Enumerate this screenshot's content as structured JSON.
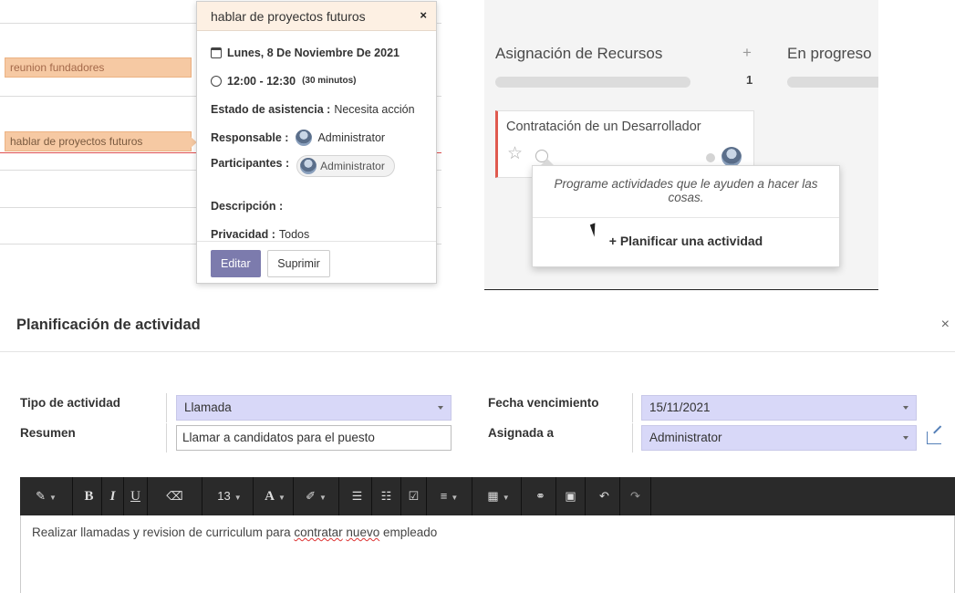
{
  "calendar": {
    "events": [
      {
        "label": "reunion fundadores"
      },
      {
        "label": "hablar de proyectos futuros"
      }
    ],
    "popover": {
      "title": "hablar de proyectos futuros",
      "close": "×",
      "date": "Lunes, 8 De Noviembre De 2021",
      "time": "12:00 - 12:30",
      "duration": "(30 minutos)",
      "attendance_label": "Estado de asistencia :",
      "attendance_value": "Necesita acción",
      "responsible_label": "Responsable :",
      "responsible_value": "Administrator",
      "participants_label": "Participantes :",
      "participant": "Administrator",
      "description_label": "Descripción :",
      "privacy_label": "Privacidad :",
      "privacy_value": "Todos",
      "edit_label": "Editar",
      "delete_label": "Suprimir",
      "edit_color": "#7c7bad"
    }
  },
  "kanban": {
    "column1_title": "Asignación de Recursos",
    "column1_add": "+",
    "column1_count": "1",
    "column2_title": "En progreso",
    "card": {
      "title": "Contratación de un Desarrollador",
      "priority_icon": "star-icon",
      "activity_icon": "clock-icon",
      "stripe_color": "#e05a4f"
    },
    "activity_popup": {
      "message": "Programe actividades que le ayuden a hacer las cosas.",
      "action": "+ Planificar una actividad"
    }
  },
  "dialog": {
    "title": "Planificación de actividad",
    "close": "×",
    "activity_type_label": "Tipo de actividad",
    "activity_type_value": "Llamada",
    "summary_label": "Resumen",
    "summary_value": "Llamar a candidatos para el puesto",
    "due_date_label": "Fecha vencimiento",
    "due_date_value": "15/11/2021",
    "assigned_label": "Asignada a",
    "assigned_value": "Administrator",
    "select_color": "#d8d8f8",
    "toolbar": {
      "style": "✎",
      "bold": "B",
      "italic": "I",
      "underline": "U",
      "eraser": "⌫",
      "font_size": "13",
      "font_color": "A",
      "highlight": "✐",
      "ul": "☰",
      "ol": "☷",
      "checklist": "☑",
      "align": "≡",
      "table": "▦",
      "link": "⚭",
      "image": "▣",
      "undo": "↶",
      "redo": "↷"
    },
    "body": {
      "before": "Realizar llamadas y revision de curriculum para ",
      "word1": "contratar",
      "space": " ",
      "word2": "nuevo",
      "after": " empleado"
    }
  }
}
